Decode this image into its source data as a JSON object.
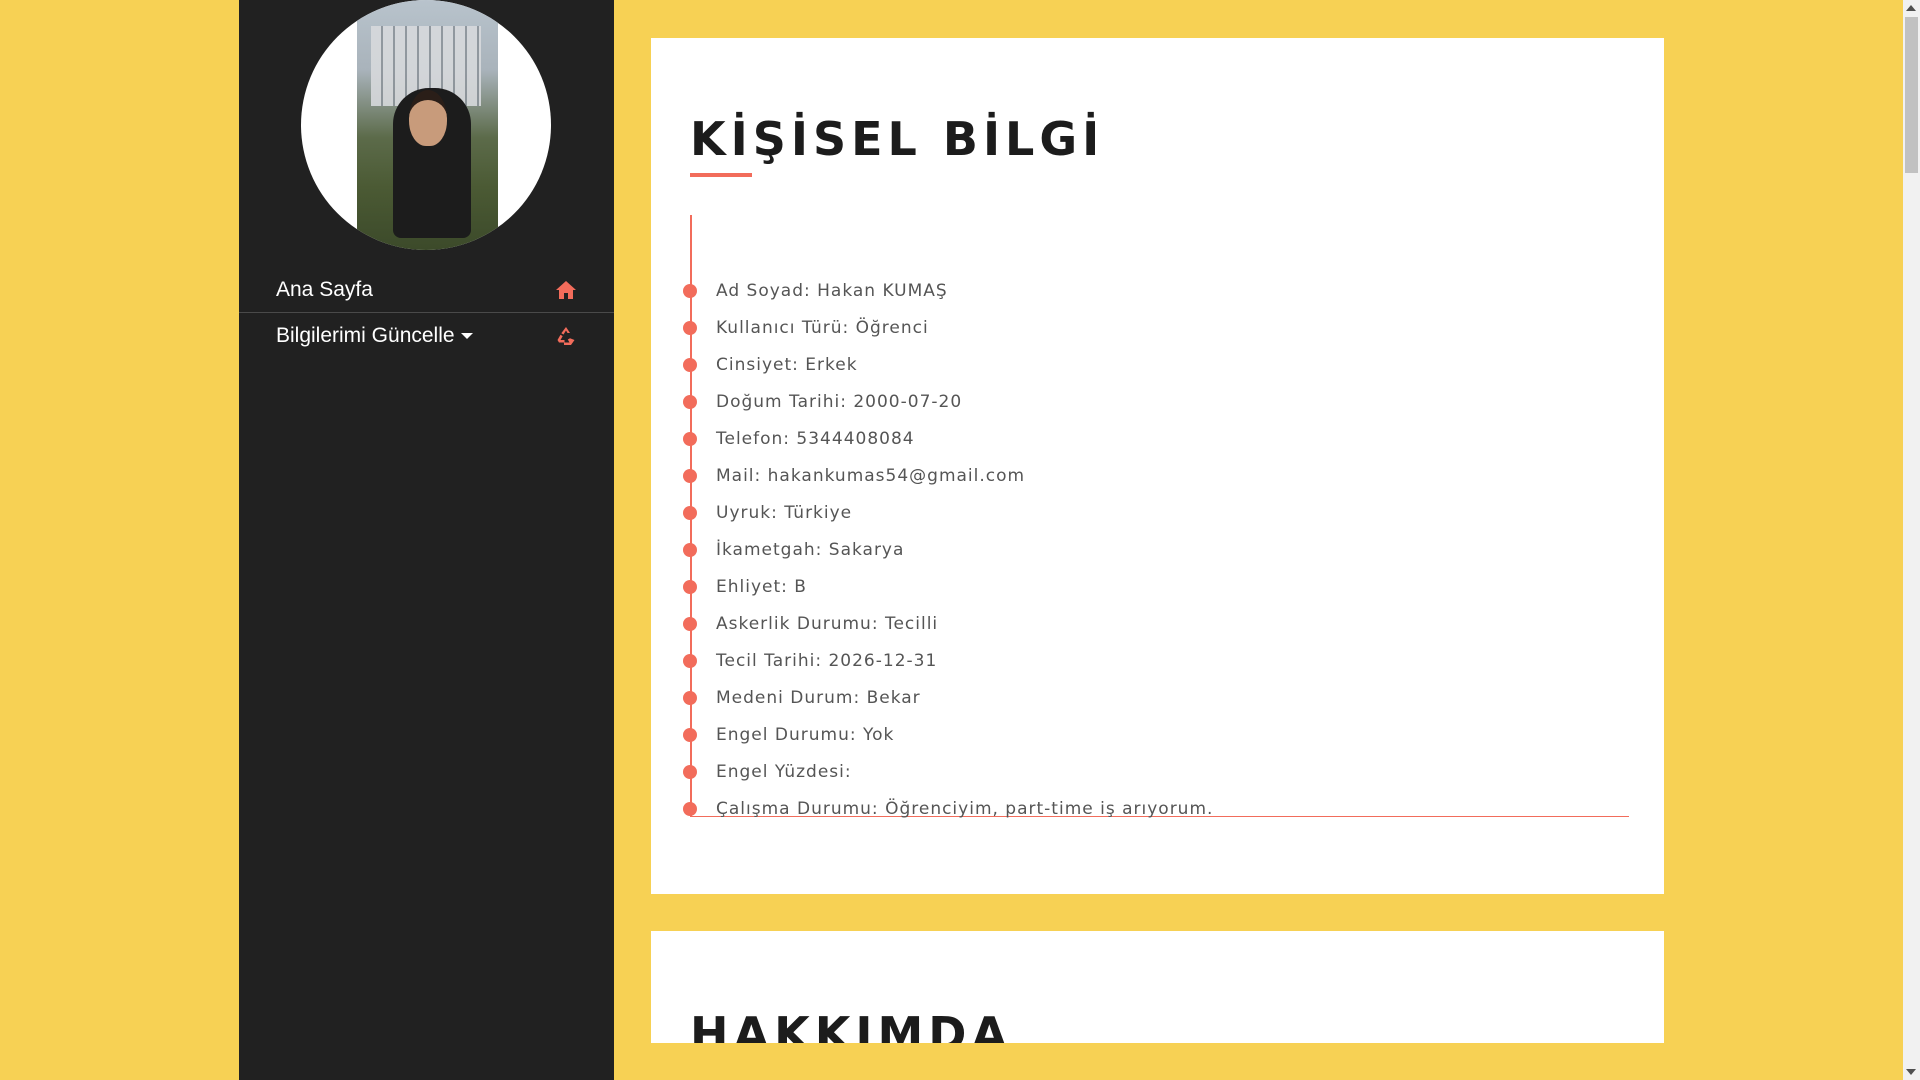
{
  "sidebar": {
    "profile_image": "profile-photo",
    "nav": [
      {
        "label": "Ana Sayfa",
        "icon": "home-icon"
      },
      {
        "label": "Bilgilerimi Güncelle",
        "icon": "recycle-icon",
        "has_dropdown": true
      }
    ]
  },
  "personal_info": {
    "title": "KİŞİSEL BİLGİ",
    "items": [
      "Ad Soyad: Hakan KUMAŞ",
      "Kullanıcı Türü: Öğrenci",
      "Cinsiyet: Erkek",
      "Doğum Tarihi: 2000-07-20",
      "Telefon: 5344408084",
      "Mail: hakankumas54@gmail.com",
      "Uyruk: Türkiye",
      "İkametgah: Sakarya",
      "Ehliyet: B",
      "Askerlik Durumu: Tecilli",
      "Tecil Tarihi: 2026-12-31",
      "Medeni Durum: Bekar",
      "Engel Durumu: Yok",
      "Engel Yüzdesi:",
      "Çalışma Durumu: Öğrenciyim, part-time iş arıyorum."
    ]
  },
  "about": {
    "title": "HAKKIMDA"
  },
  "colors": {
    "background": "#f7d154",
    "sidebar": "#212121",
    "accent": "#f26c5b",
    "card": "#ffffff"
  }
}
